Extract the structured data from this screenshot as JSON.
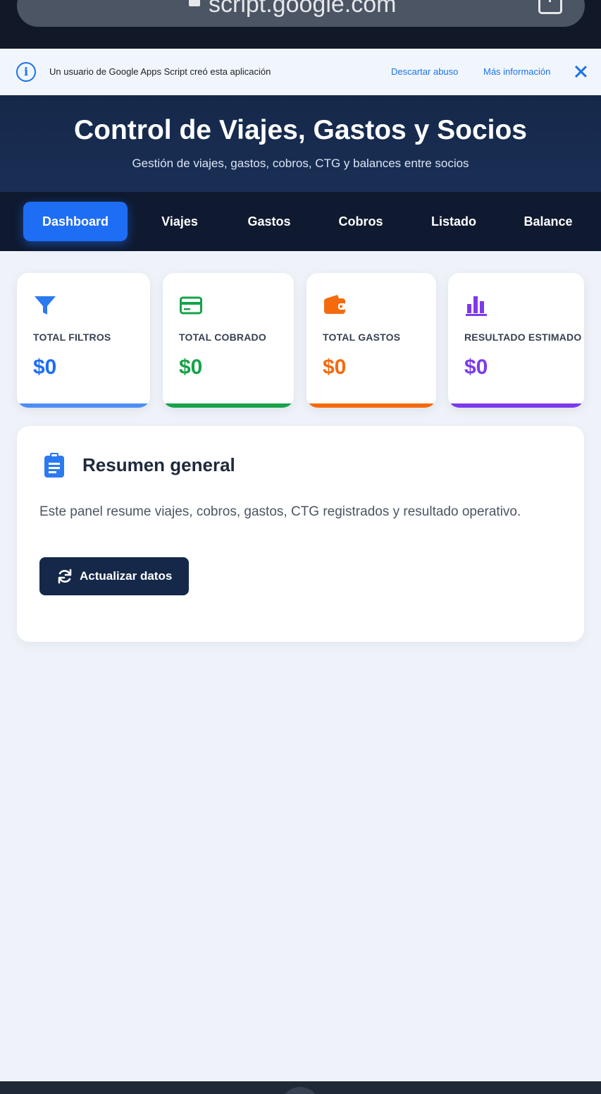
{
  "browser": {
    "url": "script.google.com"
  },
  "notice": {
    "text": "Un usuario de Google Apps Script creó esta aplicación",
    "report_link": "Descartar abuso",
    "info_link": "Más información"
  },
  "header": {
    "title": "Control de Viajes, Gastos y Socios",
    "subtitle": "Gestión de viajes, gastos, cobros, CTG y balances entre socios"
  },
  "nav": {
    "tabs": [
      {
        "label": "Dashboard",
        "active": true
      },
      {
        "label": "Viajes",
        "active": false
      },
      {
        "label": "Gastos",
        "active": false
      },
      {
        "label": "Cobros",
        "active": false
      },
      {
        "label": "Listado",
        "active": false
      },
      {
        "label": "Balance",
        "active": false
      }
    ]
  },
  "stats": [
    {
      "label": "TOTAL FILTROS",
      "value": "$0",
      "icon": "filter-icon",
      "color": "#1e6df5",
      "bar": "#4d8ef5"
    },
    {
      "label": "TOTAL COBRADO",
      "value": "$0",
      "icon": "credit-card-icon",
      "color": "#16a34a",
      "bar": "#16a34a"
    },
    {
      "label": "TOTAL GASTOS",
      "value": "$0",
      "icon": "wallet-icon",
      "color": "#f56a0c",
      "bar": "#f56a0c"
    },
    {
      "label": "RESULTADO ESTIMADO",
      "value": "$0",
      "icon": "bar-chart-icon",
      "color": "#7c3aed",
      "bar": "#7c3aed"
    }
  ],
  "summary": {
    "title": "Resumen general",
    "description": "Este panel resume viajes, cobros, gastos, CTG registrados y resultado operativo.",
    "button_label": "Actualizar datos"
  }
}
